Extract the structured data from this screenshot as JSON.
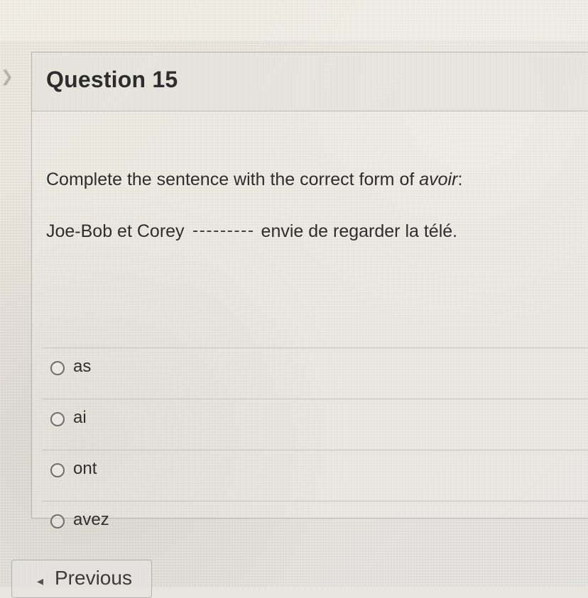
{
  "question": {
    "title": "Question 15",
    "instruction_prefix": "Complete the sentence with the correct form of ",
    "instruction_emphasis": "avoir",
    "instruction_suffix": ":",
    "sentence_prefix": "Joe-Bob et Corey",
    "sentence_suffix": "envie de regarder la télé.",
    "answers": [
      {
        "label": "as",
        "selected": false
      },
      {
        "label": "ai",
        "selected": false
      },
      {
        "label": "ont",
        "selected": false
      },
      {
        "label": "avez",
        "selected": false
      }
    ]
  },
  "navigation": {
    "previous_label": "Previous",
    "side_icon": "chevron-right-icon",
    "previous_icon": "left-caret-icon"
  },
  "colors": {
    "border": "#8a8a8a",
    "text": "#2e2e2e",
    "background": "#e9e6df"
  }
}
